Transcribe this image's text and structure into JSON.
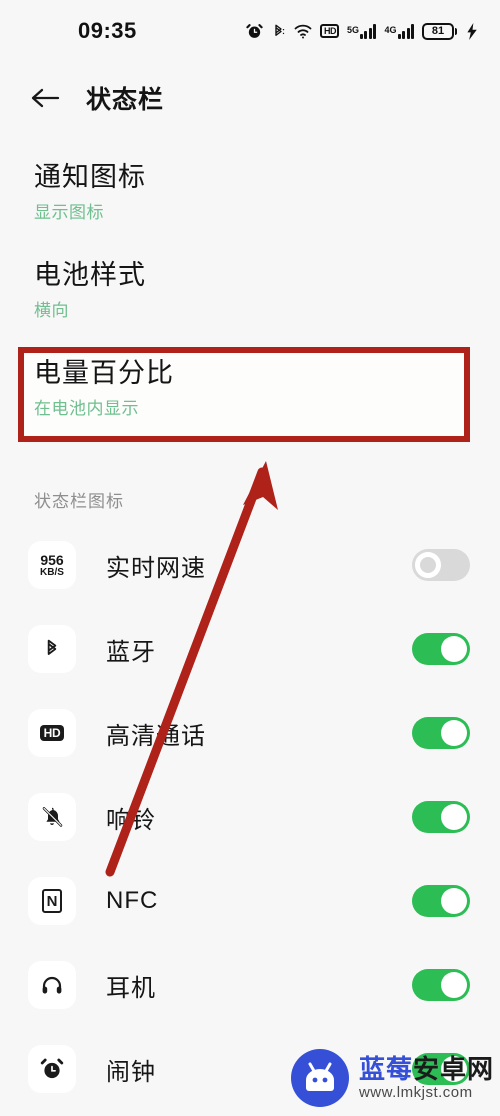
{
  "status_bar": {
    "time": "09:35",
    "icons": [
      {
        "name": "alarm-icon",
        "label": "alarm"
      },
      {
        "name": "bluetooth-icon",
        "label": "bluetooth"
      },
      {
        "name": "wifi-icon",
        "label": "wifi"
      },
      {
        "name": "hd-call-icon",
        "label": "HD"
      },
      {
        "name": "signal-5g-icon",
        "label": "5G"
      },
      {
        "name": "signal-4g-icon",
        "label": "4G"
      }
    ],
    "hd_label": "HD",
    "signal_5g_label": "5G",
    "signal_4g_label": "4G",
    "battery_level": "81"
  },
  "header": {
    "back_icon": "back-arrow-icon",
    "title": "状态栏"
  },
  "entries": [
    {
      "title": "通知图标",
      "subtitle": "显示图标"
    },
    {
      "title": "电池样式",
      "subtitle": "横向"
    },
    {
      "title": "电量百分比",
      "subtitle": "在电池内显示"
    }
  ],
  "section": {
    "label": "状态栏图标"
  },
  "rows": [
    {
      "icon": "network-speed-icon",
      "icon_num": "956",
      "icon_unit": "KB/S",
      "label": "实时网速",
      "state": "off"
    },
    {
      "icon": "bluetooth-icon",
      "label": "蓝牙",
      "state": "on"
    },
    {
      "icon": "hd-call-icon",
      "icon_text": "HD",
      "label": "高清通话",
      "state": "on"
    },
    {
      "icon": "bell-muted-icon",
      "label": "响铃",
      "state": "on"
    },
    {
      "icon": "nfc-icon",
      "icon_text": "N",
      "label": "NFC",
      "state": "on"
    },
    {
      "icon": "headphones-icon",
      "label": "耳机",
      "state": "on"
    },
    {
      "icon": "alarm-icon",
      "label": "闹钟",
      "state": "on"
    }
  ],
  "watermark": {
    "title_blue": "蓝莓",
    "title_dark": "安卓网",
    "url": "www.lmkjst.com"
  },
  "colors": {
    "accent_green": "#2cbd55",
    "subtitle_green": "#6fbf8f",
    "annotation_red": "#ae2219",
    "background": "#f7f7f7"
  }
}
